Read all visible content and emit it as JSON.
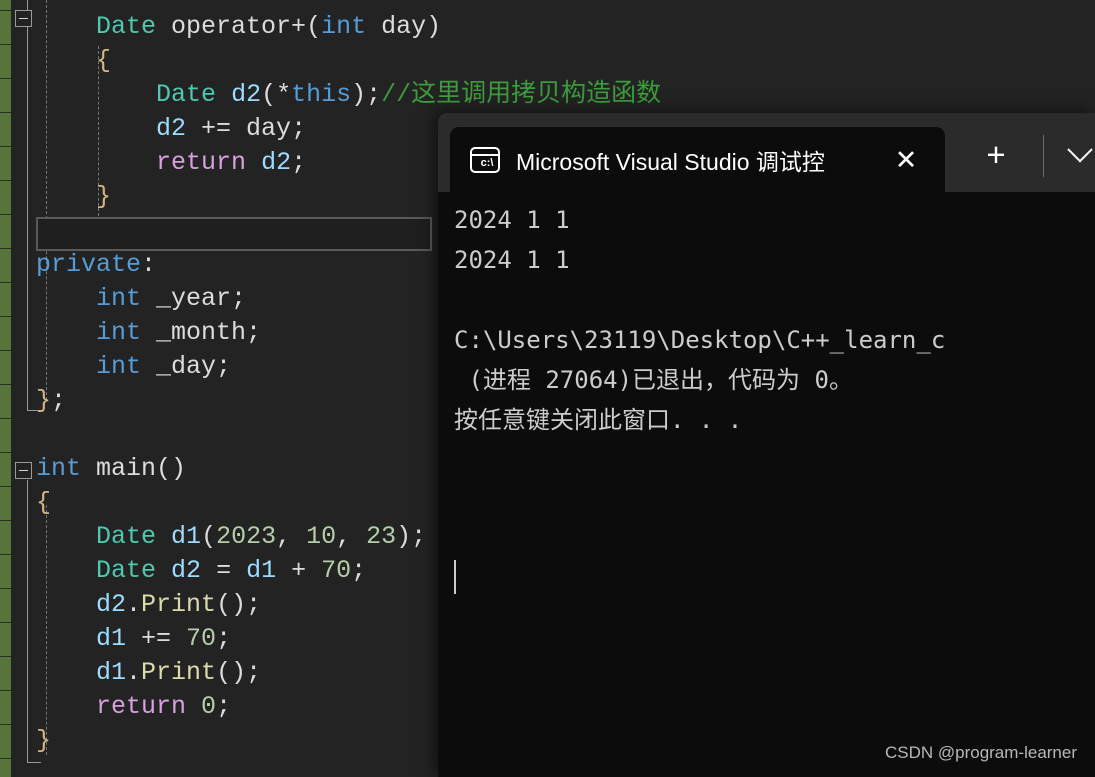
{
  "editor": {
    "name": "visual-studio-code-editor",
    "background": "#232323",
    "change_bar_color": "#57753a",
    "lines": [
      {
        "indent": 0,
        "tokens": [
          {
            "t": "    ",
            "c": "plain"
          },
          {
            "t": "Date",
            "c": "type"
          },
          {
            "t": " operator+",
            "c": "plain"
          },
          {
            "t": "(",
            "c": "punc"
          },
          {
            "t": "int",
            "c": "kw"
          },
          {
            "t": " day",
            "c": "plain"
          },
          {
            "t": ")",
            "c": "punc"
          }
        ]
      },
      {
        "indent": 0,
        "tokens": [
          {
            "t": "    {",
            "c": "brace"
          }
        ]
      },
      {
        "indent": 0,
        "tokens": [
          {
            "t": "        ",
            "c": "plain"
          },
          {
            "t": "Date",
            "c": "type"
          },
          {
            "t": " ",
            "c": "plain"
          },
          {
            "t": "d2",
            "c": "var"
          },
          {
            "t": "(*",
            "c": "punc"
          },
          {
            "t": "this",
            "c": "kw"
          },
          {
            "t": ");",
            "c": "punc"
          },
          {
            "t": "//这里调用拷贝构造函数",
            "c": "comment"
          }
        ]
      },
      {
        "indent": 0,
        "tokens": [
          {
            "t": "        ",
            "c": "plain"
          },
          {
            "t": "d2",
            "c": "var"
          },
          {
            "t": " += day;",
            "c": "plain"
          }
        ]
      },
      {
        "indent": 0,
        "tokens": [
          {
            "t": "        ",
            "c": "plain"
          },
          {
            "t": "return",
            "c": "ctrl"
          },
          {
            "t": " ",
            "c": "plain"
          },
          {
            "t": "d2",
            "c": "var"
          },
          {
            "t": ";",
            "c": "punc"
          }
        ]
      },
      {
        "indent": 0,
        "tokens": [
          {
            "t": "    }",
            "c": "brace"
          }
        ]
      },
      {
        "indent": 0,
        "tokens": [
          {
            "t": "",
            "c": "plain"
          }
        ]
      },
      {
        "indent": 0,
        "tokens": [
          {
            "t": "private",
            "c": "kw"
          },
          {
            "t": ":",
            "c": "punc"
          }
        ]
      },
      {
        "indent": 0,
        "tokens": [
          {
            "t": "    ",
            "c": "plain"
          },
          {
            "t": "int",
            "c": "kw"
          },
          {
            "t": " _year;",
            "c": "plain"
          }
        ]
      },
      {
        "indent": 0,
        "tokens": [
          {
            "t": "    ",
            "c": "plain"
          },
          {
            "t": "int",
            "c": "kw"
          },
          {
            "t": " _month;",
            "c": "plain"
          }
        ]
      },
      {
        "indent": 0,
        "tokens": [
          {
            "t": "    ",
            "c": "plain"
          },
          {
            "t": "int",
            "c": "kw"
          },
          {
            "t": " _day;",
            "c": "plain"
          }
        ]
      },
      {
        "indent": 0,
        "tokens": [
          {
            "t": "}",
            "c": "brace"
          },
          {
            "t": ";",
            "c": "punc"
          }
        ]
      },
      {
        "indent": 0,
        "tokens": [
          {
            "t": "",
            "c": "plain"
          }
        ]
      },
      {
        "indent": 0,
        "tokens": [
          {
            "t": "int",
            "c": "kw"
          },
          {
            "t": " ",
            "c": "plain"
          },
          {
            "t": "main",
            "c": "plain"
          },
          {
            "t": "()",
            "c": "punc"
          }
        ]
      },
      {
        "indent": 0,
        "tokens": [
          {
            "t": "{",
            "c": "brace"
          }
        ]
      },
      {
        "indent": 0,
        "tokens": [
          {
            "t": "    ",
            "c": "plain"
          },
          {
            "t": "Date",
            "c": "type"
          },
          {
            "t": " ",
            "c": "plain"
          },
          {
            "t": "d1",
            "c": "var"
          },
          {
            "t": "(",
            "c": "punc"
          },
          {
            "t": "2023",
            "c": "num"
          },
          {
            "t": ", ",
            "c": "punc"
          },
          {
            "t": "10",
            "c": "num"
          },
          {
            "t": ", ",
            "c": "punc"
          },
          {
            "t": "23",
            "c": "num"
          },
          {
            "t": ");",
            "c": "punc"
          }
        ]
      },
      {
        "indent": 0,
        "tokens": [
          {
            "t": "    ",
            "c": "plain"
          },
          {
            "t": "Date",
            "c": "type"
          },
          {
            "t": " ",
            "c": "plain"
          },
          {
            "t": "d2",
            "c": "var"
          },
          {
            "t": " = ",
            "c": "punc"
          },
          {
            "t": "d1",
            "c": "var"
          },
          {
            "t": " + ",
            "c": "punc"
          },
          {
            "t": "70",
            "c": "num"
          },
          {
            "t": ";",
            "c": "punc"
          }
        ]
      },
      {
        "indent": 0,
        "tokens": [
          {
            "t": "    ",
            "c": "plain"
          },
          {
            "t": "d2",
            "c": "var"
          },
          {
            "t": ".",
            "c": "punc"
          },
          {
            "t": "Print",
            "c": "fn"
          },
          {
            "t": "();",
            "c": "punc"
          }
        ]
      },
      {
        "indent": 0,
        "tokens": [
          {
            "t": "    ",
            "c": "plain"
          },
          {
            "t": "d1",
            "c": "var"
          },
          {
            "t": " += ",
            "c": "punc"
          },
          {
            "t": "70",
            "c": "num"
          },
          {
            "t": ";",
            "c": "punc"
          }
        ]
      },
      {
        "indent": 0,
        "tokens": [
          {
            "t": "    ",
            "c": "plain"
          },
          {
            "t": "d1",
            "c": "var"
          },
          {
            "t": ".",
            "c": "punc"
          },
          {
            "t": "Print",
            "c": "fn"
          },
          {
            "t": "();",
            "c": "punc"
          }
        ]
      },
      {
        "indent": 0,
        "tokens": [
          {
            "t": "    ",
            "c": "plain"
          },
          {
            "t": "return",
            "c": "ctrl"
          },
          {
            "t": " ",
            "c": "plain"
          },
          {
            "t": "0",
            "c": "num"
          },
          {
            "t": ";",
            "c": "punc"
          }
        ]
      },
      {
        "indent": 0,
        "tokens": [
          {
            "t": "}",
            "c": "brace"
          }
        ]
      }
    ]
  },
  "terminal": {
    "window_title": "Microsoft Visual Studio 调试控",
    "tab_icon_label": "c:\\",
    "icon_names": {
      "tab": "console-icon",
      "close": "close-icon",
      "new_tab": "new-tab-icon",
      "dropdown": "chevron-down-icon"
    },
    "close_label": "✕",
    "new_tab_label": "+",
    "output_lines": [
      "2024 1 1",
      "2024 1 1",
      "",
      "C:\\Users\\23119\\Desktop\\C++_learn_c",
      " (进程 27064)已退出，代码为 0。",
      "按任意键关闭此窗口. . ."
    ],
    "background": "#0c0c0c",
    "titlebar_background": "#2b2b2b"
  },
  "watermark": {
    "text": "CSDN @program-learner"
  }
}
